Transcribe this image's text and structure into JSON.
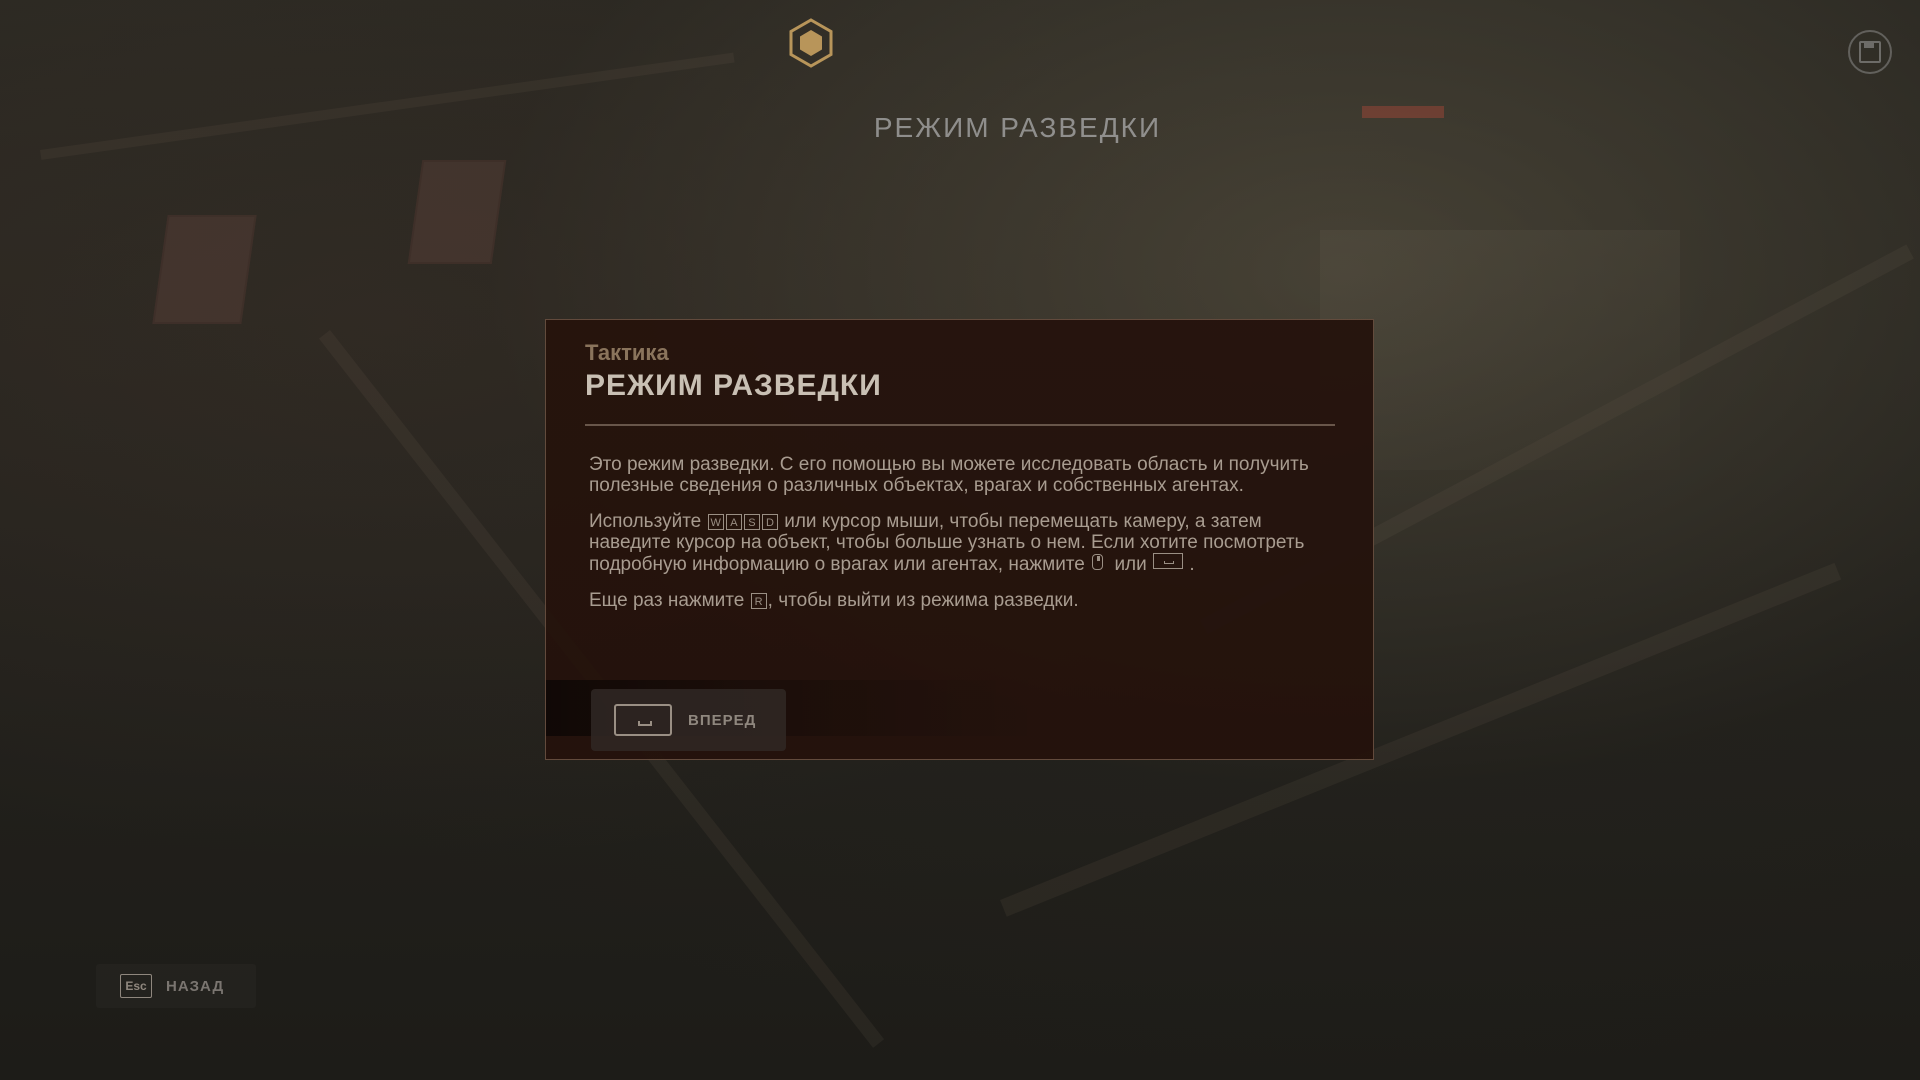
{
  "header": {
    "emblem_icon": "hexagon-emblem-icon",
    "save_icon": "save-disk-icon",
    "title": "РЕЖИМ РАЗВЕДКИ"
  },
  "dialog": {
    "category": "Тактика",
    "title": "РЕЖИМ РАЗВЕДКИ",
    "paragraph1": "Это режим разведки. С его помощью вы можете исследовать область и получить полезные сведения о различных объектах, врагах и собственных агентах.",
    "paragraph2_start": "Используйте",
    "keys_move": [
      "W",
      "A",
      "S",
      "D"
    ],
    "paragraph2_middle": "или курсор мыши, чтобы перемещать камеру, а затем наведите курсор на объект, чтобы больше узнать о нем. Если хотите посмотреть подробную информацию о врагах или агентах, нажмите",
    "paragraph2_or": "или",
    "paragraph2_end": ".",
    "paragraph3_start": "Еще раз нажмите",
    "key_exit": "R",
    "paragraph3_end": ", чтобы выйти из режима разведки.",
    "forward_label": "ВПЕРЕД"
  },
  "footer": {
    "esc_key": "Esc",
    "back_label": "НАЗАД"
  },
  "colors": {
    "dialog_bg": "#24130c",
    "dialog_border": "#96786a",
    "category": "#8a745c",
    "title": "#c9c0b4",
    "body_text": "#a89c90",
    "emblem_gold": "#b8955a"
  }
}
